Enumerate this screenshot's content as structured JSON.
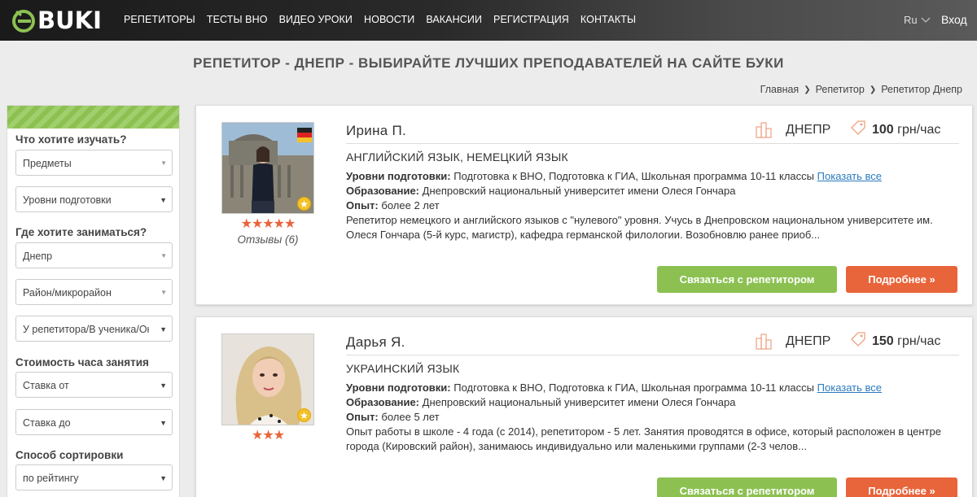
{
  "header": {
    "logo_text": "BUKI",
    "nav": [
      "РЕПЕТИТОРЫ",
      "ТЕСТЫ ВНО",
      "ВИДЕО УРОКИ",
      "НОВОСТИ",
      "ВАКАНСИИ",
      "РЕГИСТРАЦИЯ",
      "КОНТАКТЫ"
    ],
    "lang": "Ru",
    "login": "Вход"
  },
  "page_title": "РЕПЕТИТОР - ДНЕПР - ВЫБИРАЙТЕ ЛУЧШИХ ПРЕПОДАВАТЕЛЕЙ НА САЙТЕ БУКИ",
  "breadcrumb": [
    "Главная",
    "Репетитор",
    "Репетитор Днепр"
  ],
  "sidebar": {
    "what_label": "Что хотите изучать?",
    "subjects_select": "Предметы",
    "levels_select": "Уровни подготовки",
    "where_label": "Где хотите заниматься?",
    "city_select": "Днепр",
    "district_select": "Район/микрорайон",
    "place_select": "У репетитора/В ученика/Он",
    "cost_label": "Стоимость часа занятия",
    "rate_from": "Ставка от",
    "rate_to": "Ставка до",
    "sort_label": "Способ сортировки",
    "sort_select": "по рейтингу"
  },
  "labels": {
    "levels": "Уровни подготовки:",
    "education": "Образование:",
    "experience": "Опыт:",
    "show_all": "Показать все",
    "contact_btn": "Связаться с репетитором",
    "more_btn": "Подробнее »"
  },
  "tutors": [
    {
      "name": "Ирина П.",
      "city": "ДНЕПР",
      "price": "100",
      "price_unit": "грн/час",
      "subjects": "АНГЛИЙСКИЙ ЯЗЫК, НЕМЕЦКИЙ ЯЗЫК",
      "levels": "Подготовка к ВНО, Подготовка к ГИА, Школьная программа 10-11 классы",
      "education": "Днепровский национальный университет имени Олеся Гончара",
      "experience": "более 2 лет",
      "description": "Репетитор немецкого и английского языков с \"нулевого\" уровня. Учусь в Днепровском национальном университете им. Олеся Гончара (5-й курс, магистр), кафедра германской филологии. Возобновлю ранее приоб...",
      "stars": "★★★★★",
      "reviews": "Отзывы (6)"
    },
    {
      "name": "Дарья Я.",
      "city": "ДНЕПР",
      "price": "150",
      "price_unit": "грн/час",
      "subjects": "УКРАИНСКИЙ ЯЗЫК",
      "levels": "Подготовка к ВНО, Подготовка к ГИА, Школьная программа 10-11 классы",
      "education": "Днепровский национальный университет имени Олеся Гончара",
      "experience": "более 5 лет",
      "description": "Опыт работы в школе - 4 года (с 2014), репетитором - 5 лет. Занятия проводятся в офисе, который расположен в центре города (Кировский район), занимаюсь индивидуально или маленькими группами (2-3 челов...",
      "stars": "★★★"
    }
  ],
  "colors": {
    "accent_green": "#8cc152",
    "accent_orange": "#e8643a",
    "link": "#2b7abf"
  }
}
